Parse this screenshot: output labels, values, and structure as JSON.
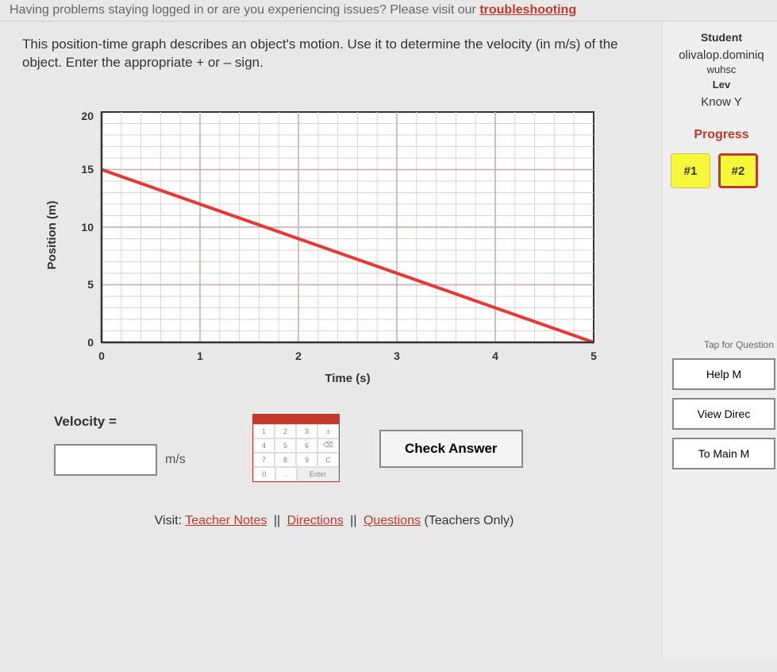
{
  "banner": {
    "text_prefix": "Having problems staying logged in or are you experiencing issues? Please visit our ",
    "link": "troubleshooting"
  },
  "question": {
    "text": "This position-time graph describes an object's motion. Use it to determine the velocity (in m/s) of the object. Enter the appropriate + or – sign."
  },
  "chart_data": {
    "type": "line",
    "title": "",
    "xlabel": "Time (s)",
    "ylabel": "Position (m)",
    "xlim": [
      0,
      5
    ],
    "ylim": [
      0,
      20
    ],
    "x_ticks": [
      0,
      1,
      2,
      3,
      4,
      5
    ],
    "y_ticks": [
      0,
      5,
      10,
      15,
      20
    ],
    "series": [
      {
        "name": "position",
        "color": "#e53935",
        "x": [
          0,
          5
        ],
        "y": [
          15,
          0
        ]
      }
    ]
  },
  "answer": {
    "label": "Velocity =",
    "value": "",
    "unit": "m/s",
    "check_button": "Check Answer"
  },
  "sidebar": {
    "student_label": "Student",
    "student_name": "olivalop.dominiq",
    "school": "wuhsc",
    "level_label": "Lev",
    "activity": "Know Y",
    "progress_label": "Progress",
    "progress_items": [
      "#1",
      "#2"
    ],
    "tap_text": "Tap for Question",
    "buttons": {
      "help": "Help M",
      "view_directions": "View Direc",
      "to_main": "To Main M"
    }
  },
  "footer": {
    "prefix": "Visit: ",
    "teacher_notes": "Teacher Notes",
    "directions": "Directions",
    "questions": "Questions",
    "suffix": " (Teachers Only)"
  }
}
